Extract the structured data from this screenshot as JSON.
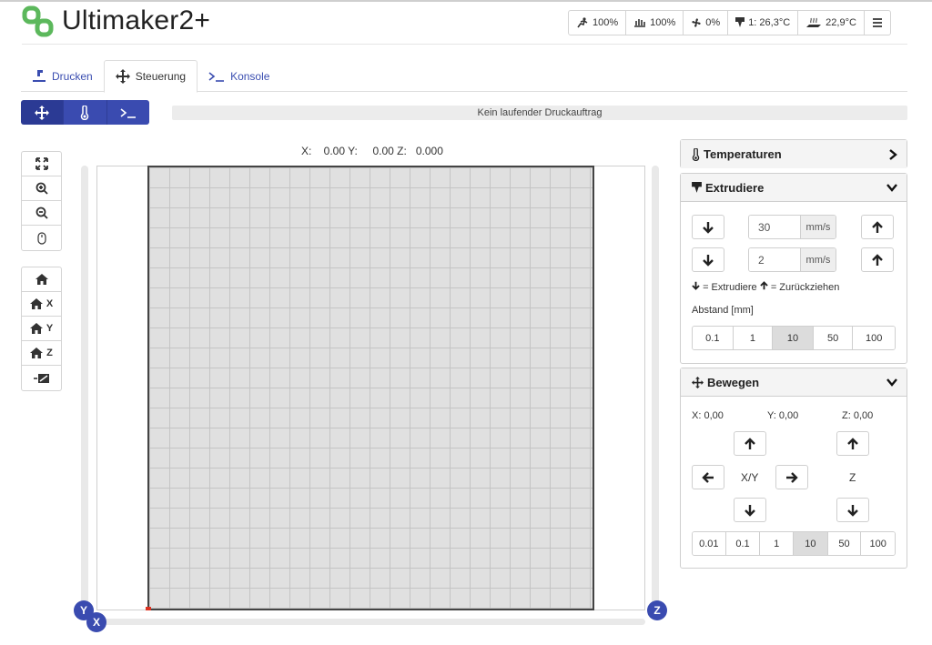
{
  "app": {
    "title": "Ultimaker2+"
  },
  "status": {
    "feedrate": "100%",
    "flowrate": "100%",
    "fan": "0%",
    "tool_temp": "1: 26,3°C",
    "bed_temp": "22,9°C"
  },
  "tabs": [
    {
      "label": "Drucken"
    },
    {
      "label": "Steuerung"
    },
    {
      "label": "Konsole"
    }
  ],
  "progress": {
    "text": "Kein laufender Druckauftrag"
  },
  "coords": {
    "text": "X:    0.00 Y:     0.00 Z:   0.000"
  },
  "home_axes": {
    "x": "X",
    "y": "Y",
    "z": "Z"
  },
  "axis_badges": {
    "y": "Y",
    "x": "X",
    "z": "Z"
  },
  "temperatures": {
    "title": "Temperaturen"
  },
  "extruders": {
    "title": "Extrudiere",
    "speed_value": "30",
    "speed_unit": "mm/s",
    "distance_value": "2",
    "distance_unit": "mm/s",
    "legend_extrude": "= Extrudiere",
    "legend_retract": "= Zurückziehen",
    "distance_label": "Abstand [mm]",
    "distances": [
      "0.1",
      "1",
      "10",
      "50",
      "100"
    ],
    "selected_distance": "10"
  },
  "move": {
    "title": "Bewegen",
    "x_pos": "X: 0,00",
    "y_pos": "Y: 0,00",
    "z_pos": "Z: 0,00",
    "xy_label": "X/Y",
    "z_label": "Z",
    "steps": [
      "0.01",
      "0.1",
      "1",
      "10",
      "50",
      "100"
    ],
    "selected_step": "10"
  },
  "colors": {
    "accent": "#3a4bb0",
    "logo_green": "#4caf50",
    "bed_fill": "#e0e0e0"
  }
}
